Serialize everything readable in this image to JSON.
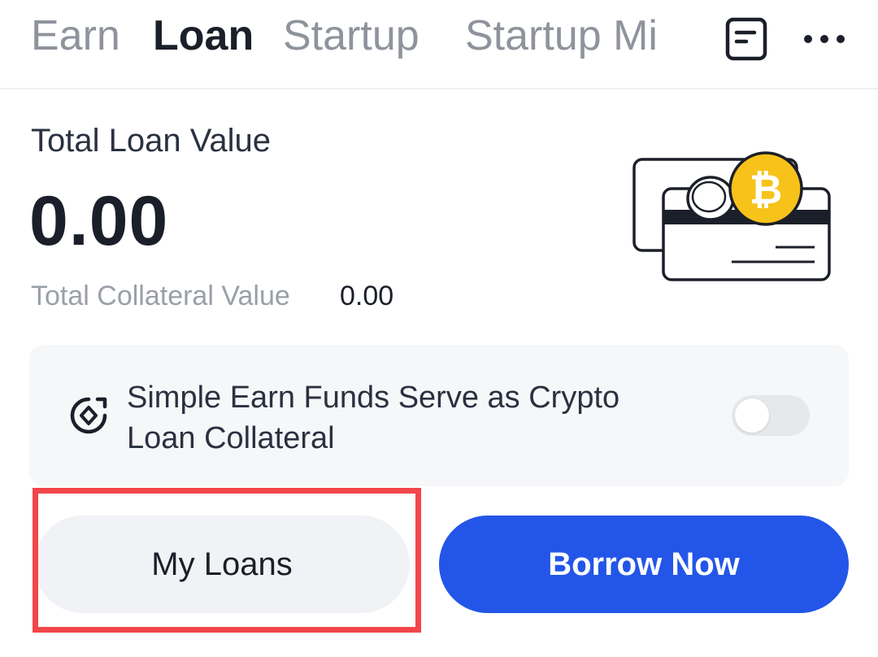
{
  "tabs": {
    "earn": "Earn",
    "loan": "Loan",
    "startup": "Startup",
    "startup_mining": "Startup Mi"
  },
  "summary": {
    "total_loan_label": "Total Loan Value",
    "total_loan_value": "0.00",
    "collateral_label": "Total Collateral Value",
    "collateral_value": "0.00"
  },
  "collateral_card": {
    "text": "Simple Earn Funds Serve as Crypto Loan Collateral",
    "toggle_on": false
  },
  "buttons": {
    "my_loans": "My Loans",
    "borrow_now": "Borrow Now"
  },
  "icons": {
    "header_right": [
      "document-icon",
      "more-icon"
    ],
    "card": "collateral-icon",
    "illustration": "crypto-card-illustration"
  },
  "colors": {
    "primary": "#2356e8",
    "coin": "#f7c21a",
    "highlight": "#f2464a"
  }
}
